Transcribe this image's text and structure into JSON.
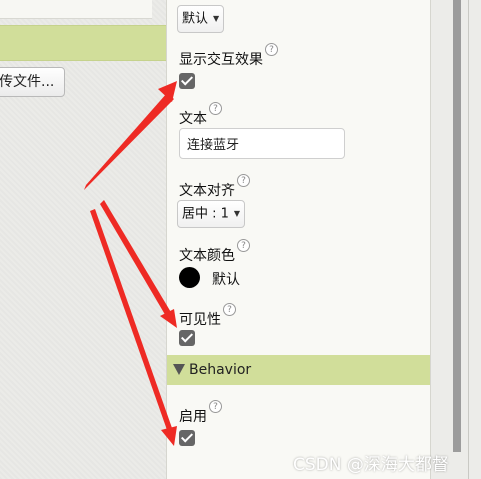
{
  "left_pane": {
    "upload_button_label": "传文件..."
  },
  "properties": {
    "top_dropdown": {
      "value": "默认"
    },
    "show_feedback": {
      "label": "显示交互效果",
      "checked": true
    },
    "text": {
      "label": "文本",
      "value": "连接蓝牙"
    },
    "text_alignment": {
      "label": "文本对齐",
      "value": "居中 : 1"
    },
    "text_color": {
      "label": "文本颜色",
      "color_name": "默认",
      "color": "#000000"
    },
    "visible": {
      "label": "可见性",
      "checked": true
    },
    "behavior_section": {
      "title": "Behavior"
    },
    "enabled": {
      "label": "启用",
      "checked": true
    }
  },
  "help_icon_glyph": "?",
  "colors": {
    "section_green": "#d1de9a",
    "arrow_red": "#ee2a24",
    "checkbox_gray": "#666666"
  },
  "watermark": "CSDN @深海大都督"
}
